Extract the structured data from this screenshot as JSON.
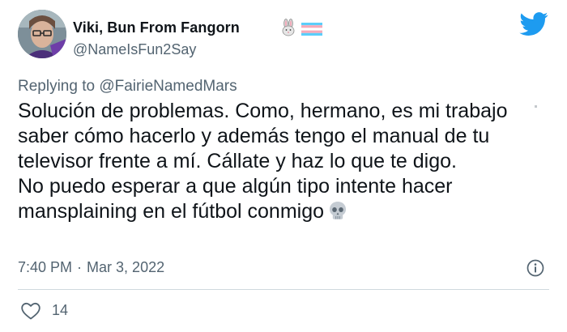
{
  "tweet": {
    "author": {
      "display_name": "Viki, Bun From Fangorn",
      "handle": "@NameIsFun2Say",
      "avatar": "avatar-photo",
      "name_emoji": "rabbit-emoji",
      "name_flag": "transgender-flag"
    },
    "platform_icon": "twitter-bird-icon",
    "replying_to": {
      "prefix": "Replying to",
      "mention": "@FairieNamedMars"
    },
    "text": {
      "paragraph1": "Solución de problemas. Como, hermano, es mi trabajo saber cómo hacerlo y además tengo el manual de tu televisor frente a mí. Cállate y haz lo que te digo.",
      "paragraph2": "No puedo esperar a que algún tipo intente hacer mansplaining en el fútbol conmigo",
      "emoji": "skull-emoji"
    },
    "timestamp": {
      "time": "7:40 PM",
      "separator": "·",
      "date": "Mar 3, 2022"
    },
    "info_icon": "info-icon",
    "likes": {
      "icon": "heart-icon",
      "count": "14"
    },
    "colors": {
      "twitter_blue": "#1d9bf0",
      "text": "#0f1419",
      "secondary_text": "#536471",
      "divider": "#cfd9de"
    }
  }
}
